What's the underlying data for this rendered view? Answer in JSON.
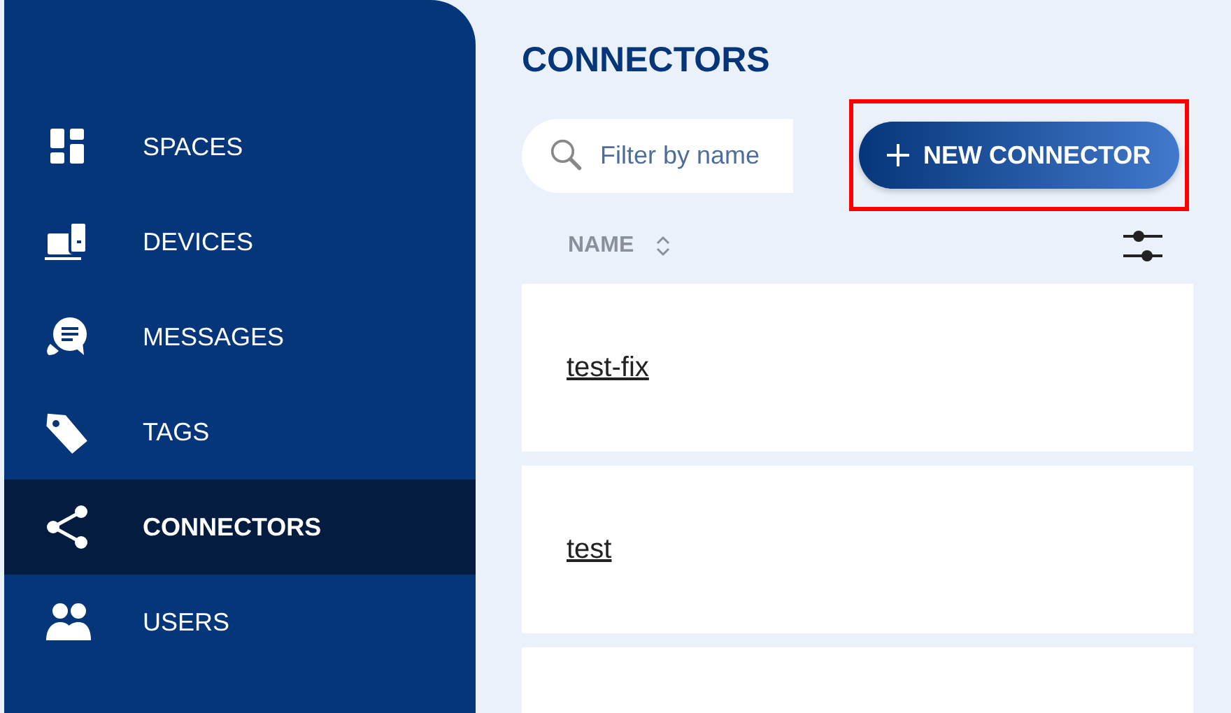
{
  "sidebar": {
    "items": [
      {
        "label": "SPACES",
        "selected": false
      },
      {
        "label": "DEVICES",
        "selected": false
      },
      {
        "label": "MESSAGES",
        "selected": false
      },
      {
        "label": "TAGS",
        "selected": false
      },
      {
        "label": "CONNECTORS",
        "selected": true
      },
      {
        "label": "USERS",
        "selected": false
      }
    ]
  },
  "page": {
    "title": "CONNECTORS",
    "search": {
      "placeholder": "Filter by name"
    },
    "new_button": {
      "label": "NEW CONNECTOR",
      "highlighted": true
    }
  },
  "table": {
    "columns": [
      {
        "label": "NAME"
      }
    ],
    "rows": [
      {
        "name": "test-fix"
      },
      {
        "name": "test"
      }
    ]
  }
}
